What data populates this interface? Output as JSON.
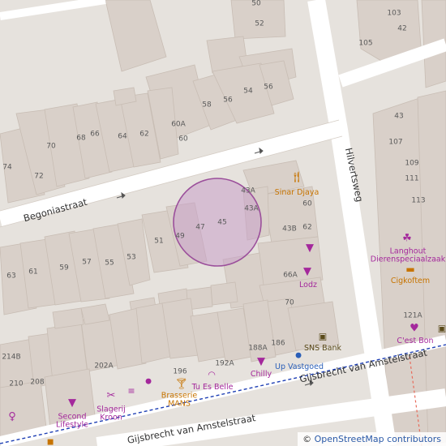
{
  "streets": {
    "begonia": "Begoniastraat",
    "hilverts": "Hilvertsweg",
    "gijs_upper": "Gijsbrecht van Amstelstraat",
    "gijs_lower": "Gijsbrecht van Amstelstraat"
  },
  "house_numbers": {
    "n50": "50",
    "n52": "52",
    "n103": "103",
    "n42": "42",
    "n105": "105",
    "n54": "54",
    "n56": "56",
    "n58": "58",
    "n60A": "60A",
    "n60": "60",
    "n62": "62",
    "n64": "64",
    "n66": "66",
    "n68": "68",
    "n70": "70",
    "n72": "72",
    "n74": "74",
    "n43": "43",
    "n107": "107",
    "n109": "109",
    "n111": "111",
    "n113": "113",
    "n43A_1": "43A",
    "n43A_2": "43A",
    "n60b": "60",
    "n62b": "62",
    "n43B": "43B",
    "n47": "47",
    "n45": "45",
    "n49": "49",
    "n51": "51",
    "n53": "53",
    "n55": "55",
    "n57": "57",
    "n59": "59",
    "n61": "61",
    "n63": "63",
    "n66A": "66A",
    "n70b": "70",
    "n121A": "121A",
    "n214B": "214B",
    "n210": "210",
    "n208": "208",
    "n202A": "202A",
    "n196": "196",
    "n192A": "192A",
    "n188A": "188A",
    "n186": "186"
  },
  "pois": {
    "sinar": "Sinar Djaya",
    "langhout": "Langhout\nDierenspeciaalzaak",
    "cigkoftem": "Cigkoftem",
    "lodz": "Lodz",
    "snsbank": "SNS Bank",
    "cestbon": "C'est Bon",
    "chilly": "Chilly",
    "upvastgoed": "Up Vastgoed",
    "tuesbelle": "Tu Es Belle",
    "brasserie": "Brasserie\nMANS",
    "slagerij": "Slagerij\nKroon",
    "secondlifestyle": "Second\nLifestyle"
  },
  "attribution": {
    "symbol": "©",
    "link": "OpenStreetMap contributors"
  },
  "colors": {
    "background": "#e6e2dd",
    "building": "#d9d0c9",
    "road": "#ffffff",
    "highlight_fill": "#c8a0c8",
    "highlight_stroke": "#9b4f9b",
    "shop_purple": "#a4289c",
    "food_orange": "#c77400",
    "bus_route": "#1e3fb4"
  }
}
